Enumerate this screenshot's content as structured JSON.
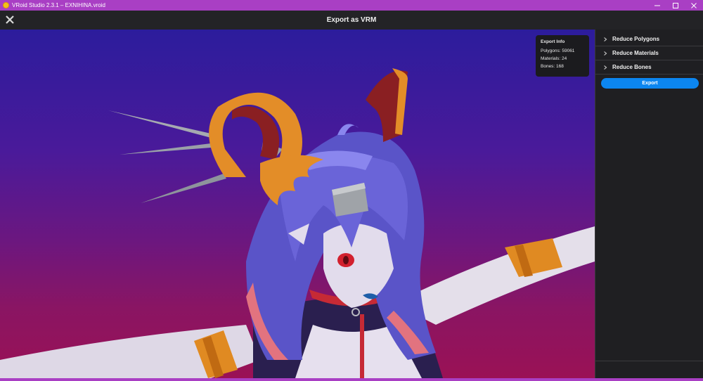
{
  "window": {
    "title": "VRoid Studio 2.3.1 – EXNIHINA.vroid",
    "controls": [
      "minimize-icon",
      "maximize-icon",
      "close-icon"
    ]
  },
  "header": {
    "title": "Export as VRM",
    "close_icon": "close-icon"
  },
  "export_info": {
    "title": "Export Info",
    "polygons": "Polygons: 59061",
    "materials": "Materials: 24",
    "bones": "Bones: 168"
  },
  "panel": {
    "sections": [
      {
        "label": "Reduce Polygons",
        "icon": "chevron-right-icon"
      },
      {
        "label": "Reduce Materials",
        "icon": "chevron-right-icon"
      },
      {
        "label": "Reduce Bones",
        "icon": "chevron-right-icon"
      }
    ],
    "export_label": "Export"
  },
  "colors": {
    "titlebar": "#a93fc4",
    "accent": "#0c86f0",
    "viewport_top": "#2c1c9c",
    "viewport_bottom": "#9a1155"
  }
}
